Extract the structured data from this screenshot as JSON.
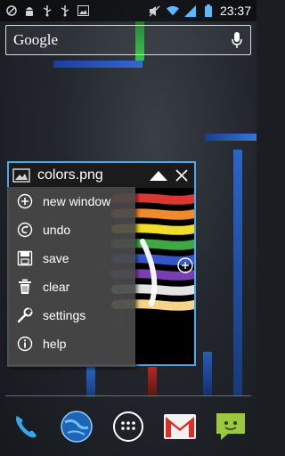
{
  "status_bar": {
    "left_icons": [
      "blocked-icon",
      "android-icon",
      "usb-icon",
      "usb-icon",
      "image-icon"
    ],
    "right_icons": [
      "mute-icon",
      "wifi-icon",
      "signal-icon",
      "battery-icon"
    ],
    "time": "23:37"
  },
  "search": {
    "logo": "Google",
    "mic_icon": "mic-icon"
  },
  "widget": {
    "title": "colors.png",
    "title_icon": "image-icon",
    "buttons": [
      "triangle-up-icon",
      "close-icon"
    ],
    "border_color": "#4fa8e8"
  },
  "menu": {
    "items": [
      {
        "label": "new window",
        "icon": "plus-circle-icon"
      },
      {
        "label": "undo",
        "icon": "undo-icon"
      },
      {
        "label": "save",
        "icon": "floppy-icon"
      },
      {
        "label": "clear",
        "icon": "trash-icon"
      },
      {
        "label": "settings",
        "icon": "wrench-icon"
      },
      {
        "label": "help",
        "icon": "info-icon"
      }
    ]
  },
  "dock": {
    "apps": [
      "phone-icon",
      "browser-icon",
      "app-drawer-icon",
      "gmail-icon",
      "messaging-icon"
    ]
  },
  "colors": {
    "accent": "#4fa8e8",
    "stripes": [
      "#d8382f",
      "#f08a2a",
      "#f0dc2c",
      "#3fa843",
      "#3456c8",
      "#7a3fae",
      "#e3e3e3",
      "#f5d48a"
    ]
  }
}
